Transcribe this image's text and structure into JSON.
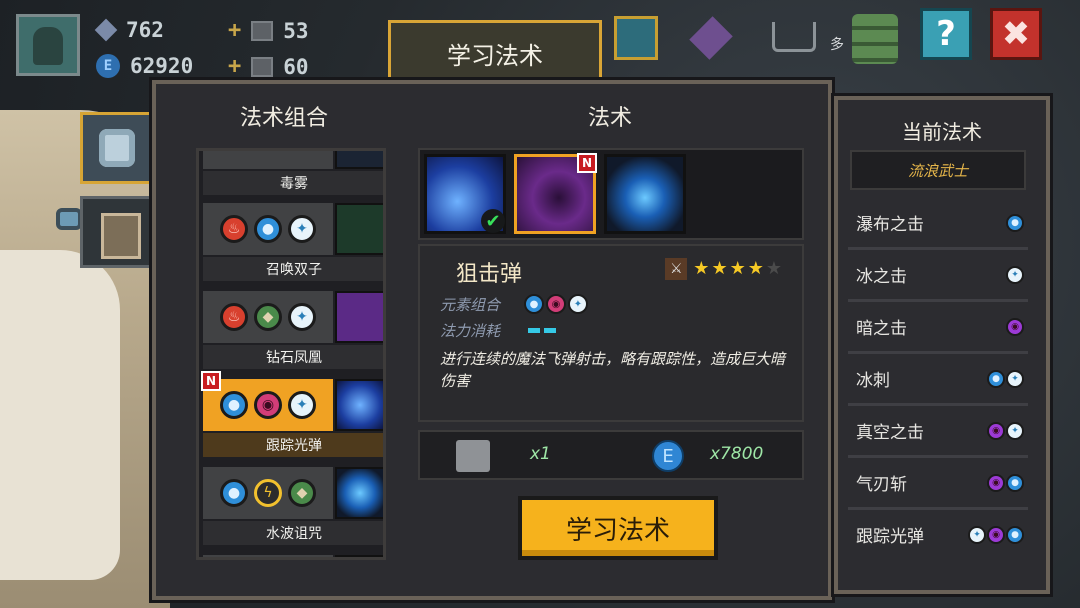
{
  "resources": {
    "gems": "762",
    "coins": "62920",
    "item_a": "53",
    "item_b": "60"
  },
  "top": {
    "learn_tab_label": "学习法术",
    "more_label": "多",
    "help_label": "?",
    "close_label": "✖"
  },
  "panel": {
    "combos_title": "法术组合",
    "spells_title": "法术",
    "combos": [
      {
        "name": "毒雾",
        "elements": []
      },
      {
        "name": "召唤双子",
        "elements": [
          "fire",
          "water",
          "ice"
        ]
      },
      {
        "name": "钻石凤凰",
        "elements": [
          "fire",
          "earth",
          "ice"
        ]
      },
      {
        "name": "跟踪光弹",
        "elements": [
          "water",
          "dark",
          "ice"
        ],
        "new": true,
        "selected": true
      },
      {
        "name": "水波诅咒",
        "elements": [
          "water",
          "thunder",
          "earth"
        ]
      }
    ],
    "new_badge": "N",
    "spell_name": "狙击弹",
    "rating": {
      "value": 4,
      "max": 5
    },
    "attr_element_label": "元素组合",
    "attr_cost_label": "法力消耗",
    "description": "进行连续的魔法飞弹射击，略有跟踪性，造成巨大暗伤害",
    "cost_item_amount": "x1",
    "cost_coin_amount": "x7800",
    "learn_button_label": "学习法术"
  },
  "current": {
    "title": "当前法术",
    "class_name": "流浪武士",
    "items": [
      {
        "label": "瀑布之击",
        "elements": [
          "water"
        ]
      },
      {
        "label": "冰之击",
        "elements": [
          "ice"
        ]
      },
      {
        "label": "暗之击",
        "elements": [
          "dark"
        ]
      },
      {
        "label": "冰刺",
        "elements": [
          "water",
          "ice"
        ]
      },
      {
        "label": "真空之击",
        "elements": [
          "dark",
          "ice"
        ]
      },
      {
        "label": "气刃斩",
        "elements": [
          "dark",
          "water"
        ]
      },
      {
        "label": "跟踪光弹",
        "elements": [
          "ice",
          "dark",
          "water"
        ]
      }
    ]
  },
  "icons": {
    "fire": "fire-icon",
    "water": "water-drop-icon",
    "ice": "ice-crystal-icon",
    "earth": "earth-icon",
    "dark": "dark-orb-icon",
    "thunder": "thunder-icon"
  }
}
